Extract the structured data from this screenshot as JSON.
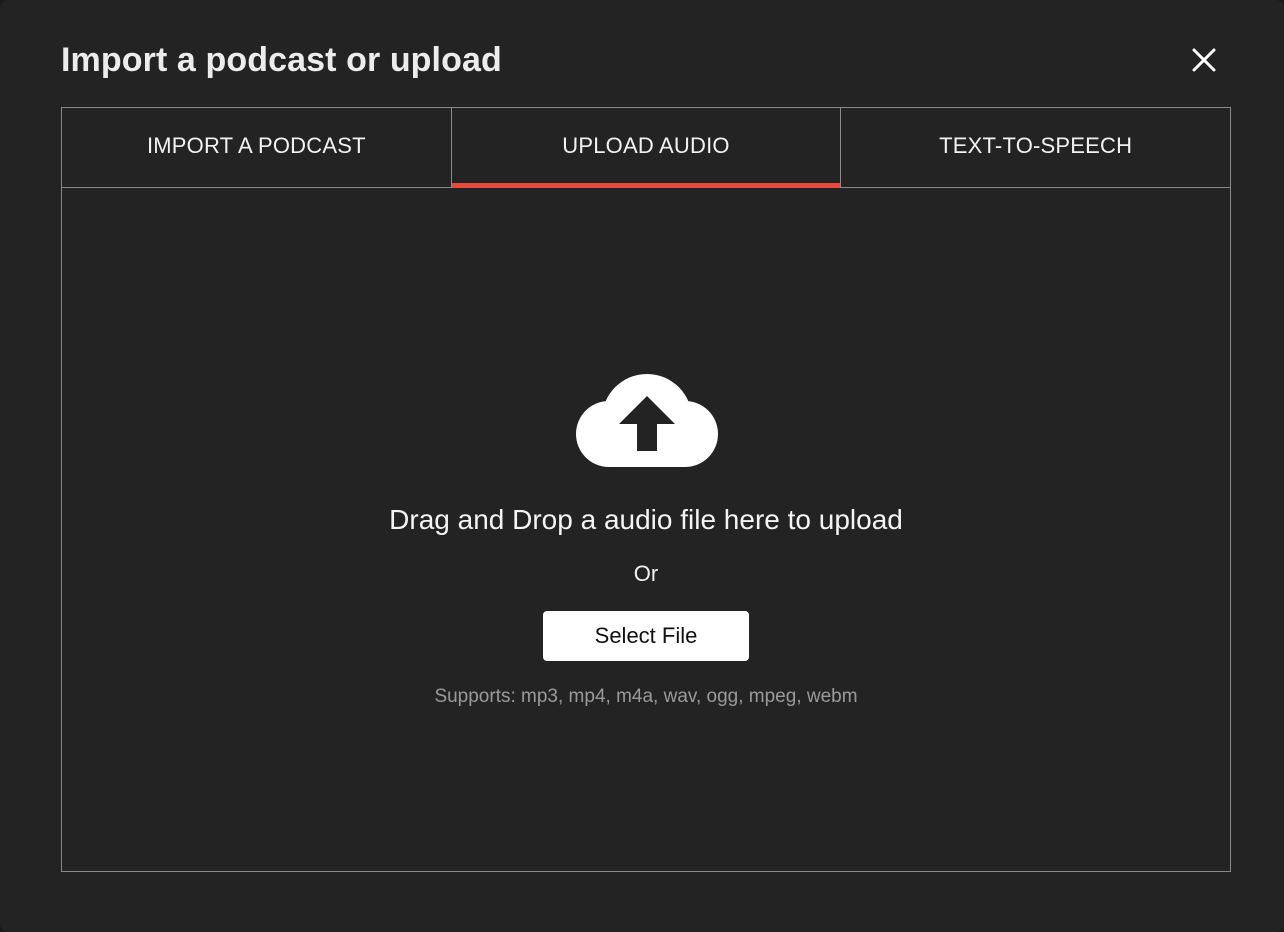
{
  "modal": {
    "title": "Import a podcast or upload"
  },
  "tabs": [
    {
      "label": "IMPORT A PODCAST",
      "active": false
    },
    {
      "label": "UPLOAD AUDIO",
      "active": true
    },
    {
      "label": "TEXT-TO-SPEECH",
      "active": false
    }
  ],
  "upload": {
    "icon": "cloud-upload-icon",
    "drop_text": "Drag and Drop a audio file here to upload",
    "or_text": "Or",
    "select_button": "Select File",
    "supports_text": "Supports: mp3, mp4, m4a, wav, ogg, mpeg, webm"
  },
  "colors": {
    "background": "#232323",
    "border": "#8a8a8a",
    "accent": "#e8493f",
    "text": "#f2f2f2",
    "muted_text": "#9a9a9a",
    "button_bg": "#ffffff"
  }
}
